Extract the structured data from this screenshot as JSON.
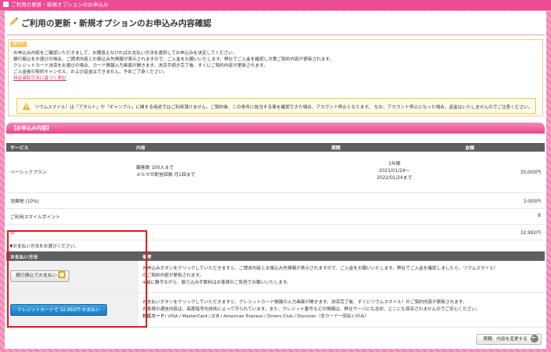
{
  "window": {
    "title": "ご利用の更新・新規オプションのお申込み"
  },
  "page": {
    "title": "ご利用の更新・新規オプションのお申込み内容確認"
  },
  "guide": {
    "tag": "ガイド",
    "lines": [
      "お申込み内容をご確認いただきまして、お間違えなければお支払い方法を選択してお申込みを決定してください。",
      "銀行振込をお選びの場合、ご請求内容とお振込み先情報が表示されますので、ご入金をお願いいたします。弊社でご入金を確認し次第ご契約内容が更新されます。",
      "クレジットカード決済をお選びの場合、カード情報入力画面が開きます。決済手続き完了後、すぐにご契約内容が更新されます。",
      "ご入金後の契約キャンセル、および返金はできません。予めご了承ください。"
    ],
    "link": "特定商取引法に基づく表記",
    "warning": "リウムスマイル！は「アダルト」や「ギャンブル」に関する用途ではご利用頂けません。ご契約後、この条件に該当する事を確認できた場合、アカウント停止となります。 なお、アカウント停止になった場合、返金はいたしませんのでご注意ください。"
  },
  "order": {
    "section_title": "【お申込み内容】",
    "headers": [
      "サービス",
      "内容",
      "期間",
      "金額"
    ],
    "basic": {
      "service": "ベーシックプラン",
      "content_lines": [
        "顧客数 100人まで",
        "メルマガ配信回数 月1回まで"
      ],
      "period_lines": [
        "1年間",
        "2021/01/24～",
        "2022/01/24まで"
      ],
      "amount": "30,000円"
    },
    "tax": {
      "label": "消費税 (10%)",
      "amount": "3,000円"
    },
    "points": {
      "label": "ご利用スマイルポイント",
      "amount": "8"
    },
    "total": {
      "label": "計",
      "amount": "32,992円"
    }
  },
  "payment": {
    "prompt": "▼お支払い方法をお選びください。",
    "headers": [
      "お支払い方法",
      "備考"
    ],
    "bank": {
      "button": "銀行振込でお支払い",
      "notes": [
        "お申込みボタンをクリックしていただきますと、ご請求内容とお振込み先情報が表示されますので、ご入金をお願いいたします。弊社でご入金を確認しましたら、リウムスマイル！",
        "のご契約内容が更新されます。",
        "※誠に勝手ながら、振り込み手数料はお客様のご負担でお願いいたします。"
      ]
    },
    "card": {
      "button": "クレジットカードで 32,992円 お支払い",
      "notes": [
        "お支払いボタンをクリックしていただきますと、クレジットカード情報の入力画面が開きます。決済完了後、すぐにリウムスマイル！のご契約内容が更新されます。",
        "お客様の通信内容は、高度暗号化技術によって守られています。また、クレジット番号などの情報は、弊社サーバにも含め、どこにも保存されませんのでご安心ください。"
      ],
      "cards_label": "対応カード:",
      "cards_value": " VISA / MasterCard / JCB / American Express / Diners Club / Discover（全カード一回払いのみ）"
    }
  },
  "footer": {
    "back_button": "期間、内容を変更する"
  },
  "colors": {
    "accent": "#ea4d93",
    "highlight": "#e81818",
    "card_button": "#1c78c2"
  }
}
